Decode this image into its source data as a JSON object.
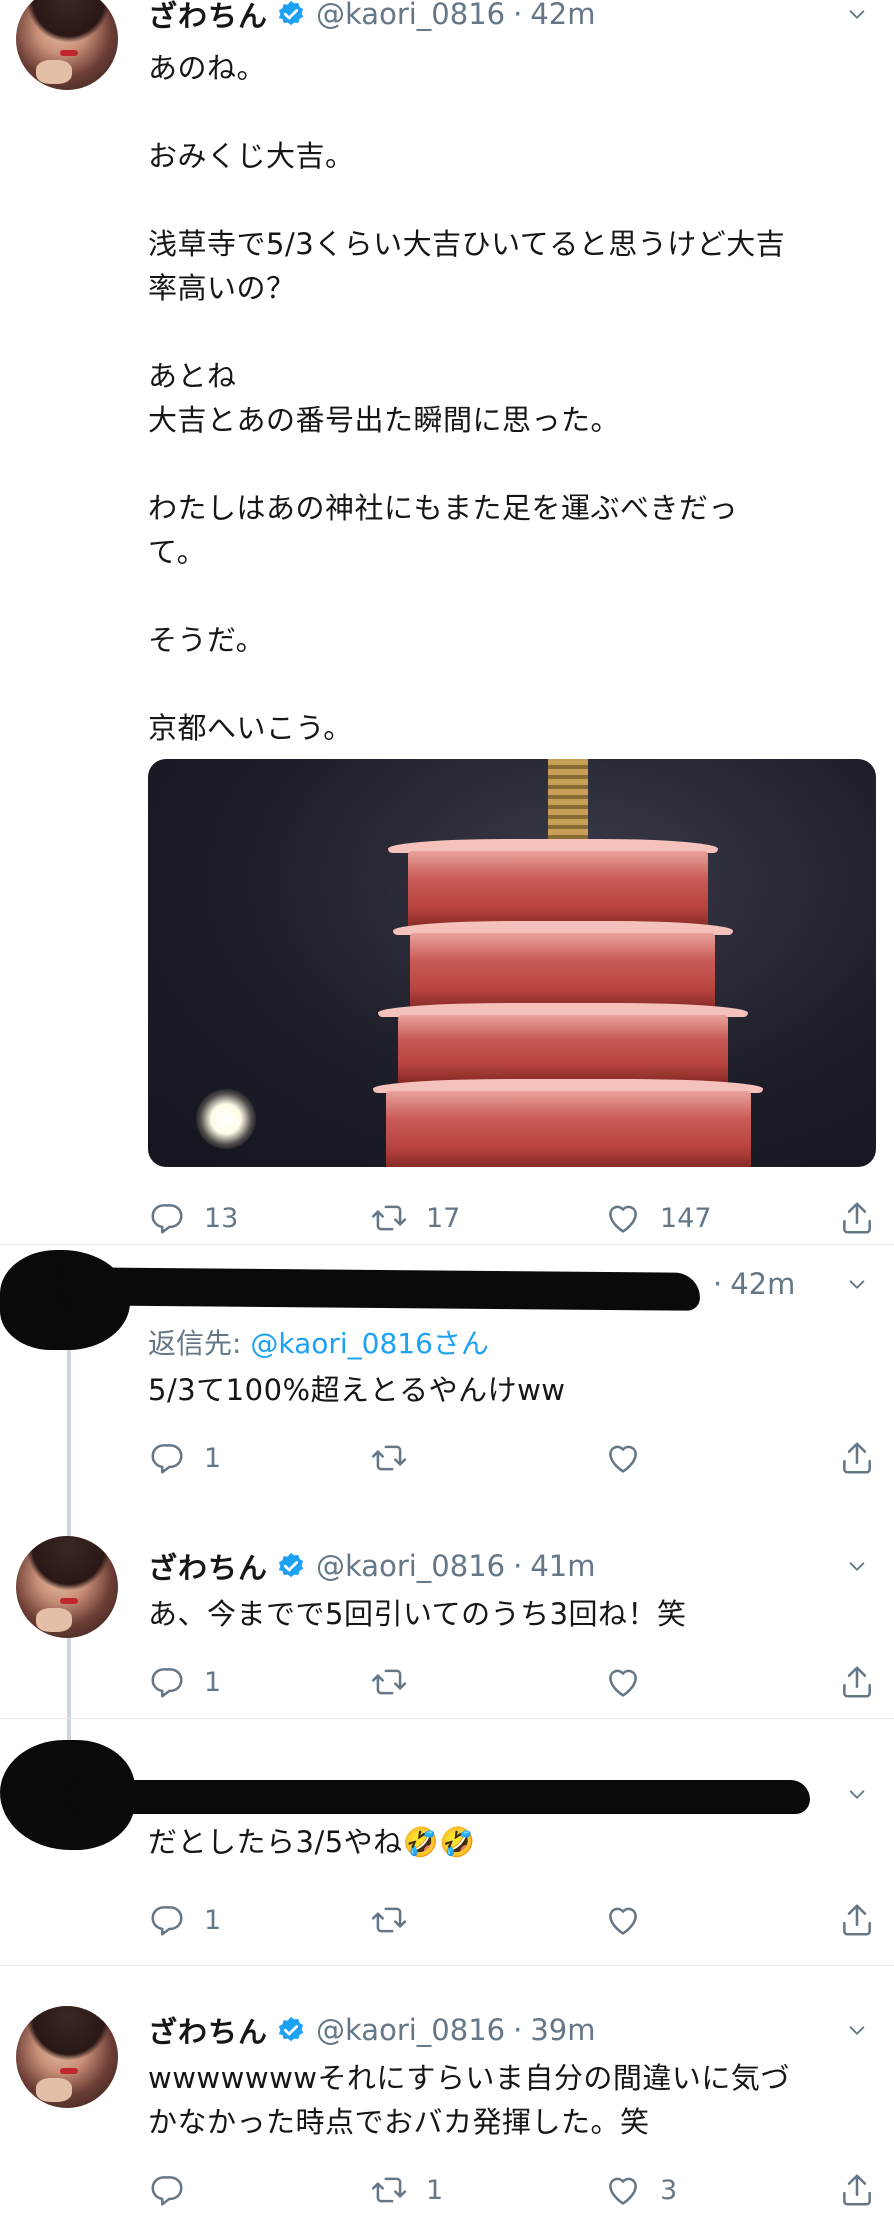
{
  "tweets": [
    {
      "name": "ざわちん",
      "handle": "@kaori_0816",
      "time": "42m",
      "text": "あのね。\n\nおみくじ大吉。\n\n浅草寺で5/3くらい大吉ひいてると思うけど大吉\n率高いの？\n\nあとね\n大吉とあの番号出た瞬間に思った。\n\nわたしはあの神社にもまた足を運ぶべきだっ\nて。\n\nそうだ。\n\n京都へいこう。",
      "replies": "13",
      "retweets": "17",
      "likes": "147"
    },
    {
      "time": "42m",
      "reply_label": "返信先: ",
      "reply_mention": "@kaori_0816さん",
      "text": "5/3て100%超えとるやんけww",
      "replies": "1",
      "retweets": "",
      "likes": ""
    },
    {
      "name": "ざわちん",
      "handle": "@kaori_0816",
      "time": "41m",
      "text": "あ、今までで5回引いてのうち3回ね！笑",
      "replies": "1",
      "retweets": "",
      "likes": ""
    },
    {
      "text": "だとしたら3/5やね🤣🤣",
      "replies": "1",
      "retweets": "",
      "likes": ""
    },
    {
      "name": "ざわちん",
      "handle": "@kaori_0816",
      "time": "39m",
      "text": "wwwwwwwそれにすらいま自分の間違いに気づ\nかなかった時点でおバカ発揮した。笑",
      "replies": "",
      "retweets": "1",
      "likes": "3"
    }
  ],
  "icons": {
    "reply": "reply-icon",
    "retweet": "retweet-icon",
    "like": "heart-icon",
    "share": "share-icon",
    "verified": "verified-badge-icon",
    "more": "chevron-down-icon"
  },
  "colors": {
    "text": "#14171a",
    "secondary": "#657786",
    "link": "#1da1f2",
    "verified": "#1da1f2",
    "thread_line": "#ccd6dd"
  }
}
